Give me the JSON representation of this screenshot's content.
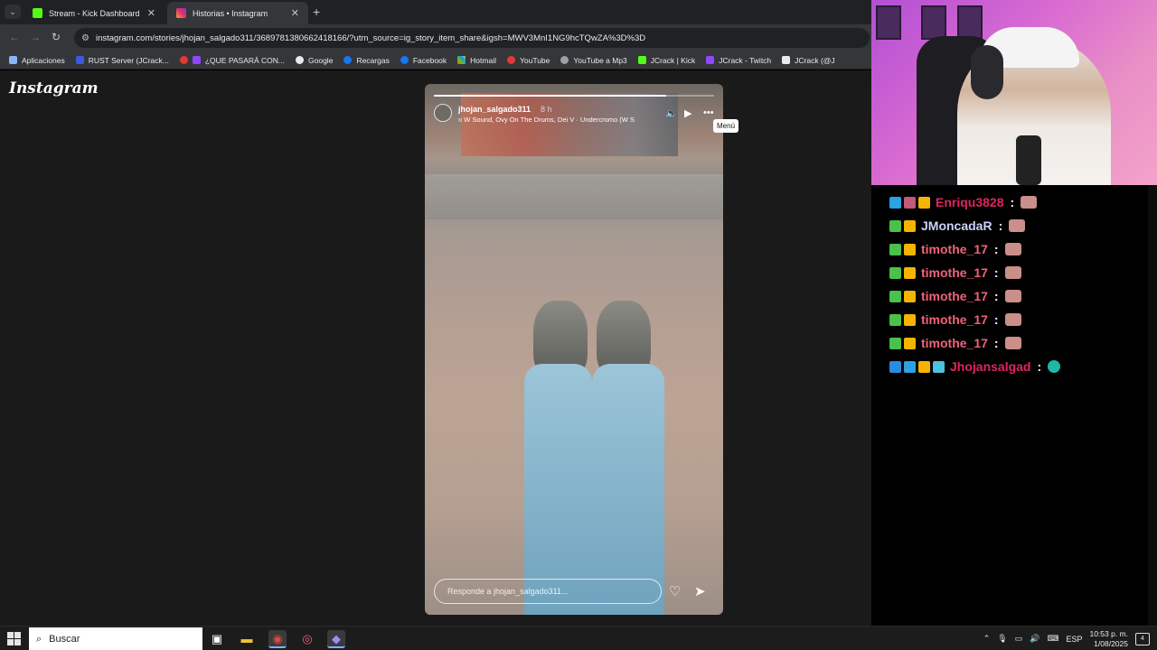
{
  "browser": {
    "tabs": [
      {
        "label": "Stream - Kick Dashboard",
        "active": false
      },
      {
        "label": "Historias • Instagram",
        "active": true
      }
    ],
    "url": "instagram.com/stories/jhojan_salgado311/3689781380662418166/?utm_source=ig_story_item_share&igsh=MWV3MnI1NG9hcTQwZA%3D%3D",
    "bookmarks": [
      "Aplicaciones",
      "RUST Server (JCrack...",
      "¿QUE PASARÁ CON...",
      "Google",
      "Recargas",
      "Facebook",
      "Hotmail",
      "YouTube",
      "YouTube a Mp3",
      "JCrack | Kick",
      "JCrack - Twitch",
      "JCrack (@J"
    ]
  },
  "instagram": {
    "logo": "Instagram",
    "story": {
      "username": "jhojan_salgado311",
      "age": "8 h",
      "music": "W Sound, Ovy On The Drums, Dei V · Undercromo (W S",
      "progress": 0.83,
      "menu_tooltip": "Menú",
      "reply_placeholder": "Responde a jhojan_salgado311..."
    }
  },
  "chat": {
    "messages": [
      {
        "user": "Enriqu3828",
        "color": "#e0245e"
      },
      {
        "user": "JMoncadaR",
        "color": "#c9d3ff"
      },
      {
        "user": "timothe_17",
        "color": "#f0627a"
      },
      {
        "user": "timothe_17",
        "color": "#f0627a"
      },
      {
        "user": "timothe_17",
        "color": "#f0627a"
      },
      {
        "user": "timothe_17",
        "color": "#f0627a"
      },
      {
        "user": "timothe_17",
        "color": "#f0627a"
      },
      {
        "user": "Jhojansalgad",
        "color": "#e0245e"
      }
    ]
  },
  "taskbar": {
    "search_placeholder": "Buscar",
    "language": "ESP",
    "time": "10:53 p. m.",
    "date": "1/08/2025",
    "notifications": "4"
  }
}
